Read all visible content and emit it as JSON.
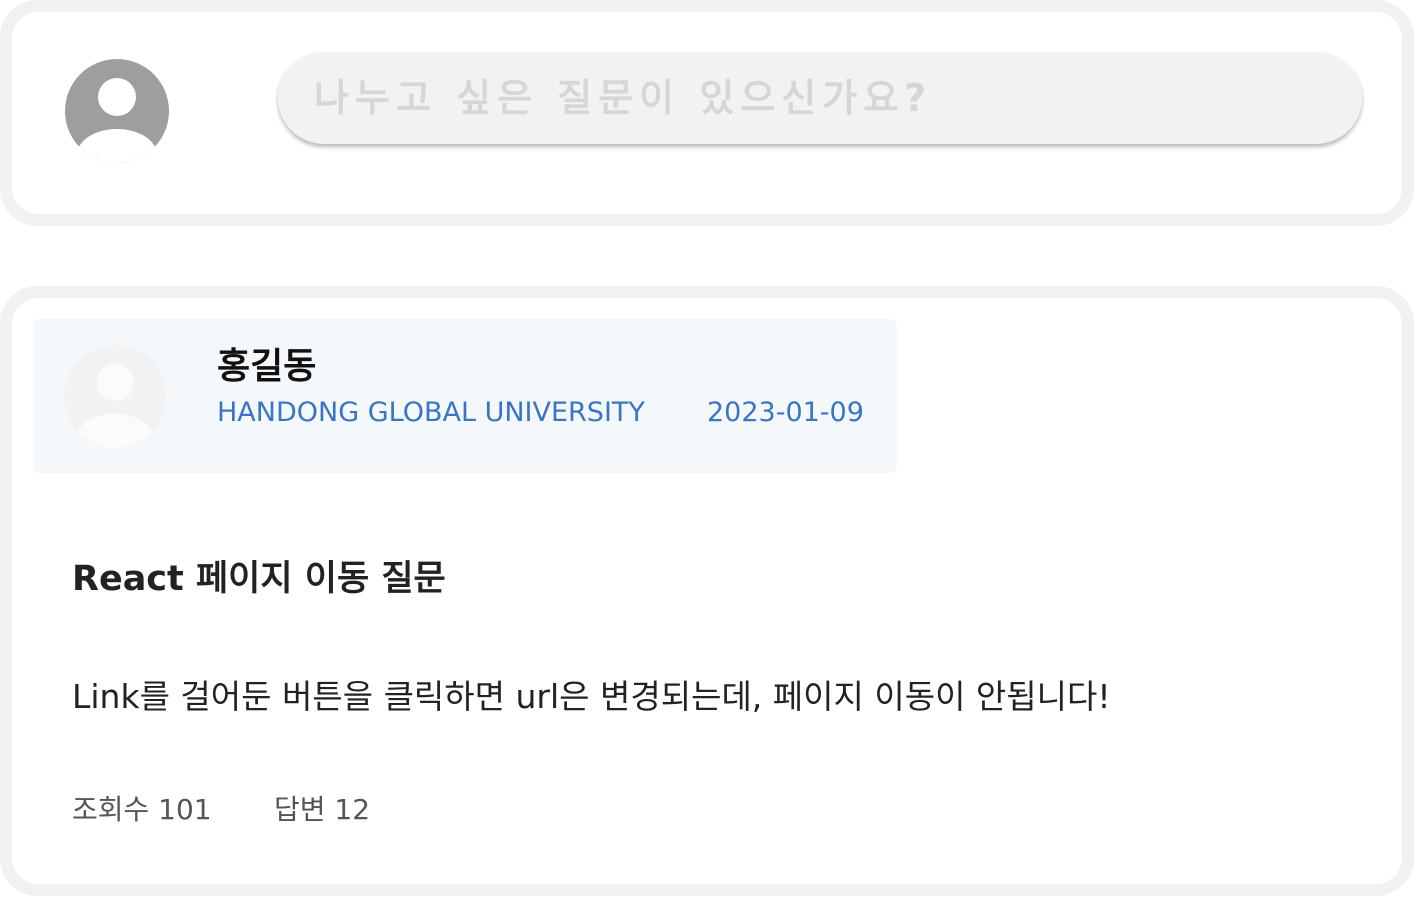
{
  "composer": {
    "placeholder": "나누고 싶은 질문이 있으신가요?"
  },
  "post": {
    "author": {
      "name": "홍길동",
      "school": "HANDONG GLOBAL UNIVERSITY",
      "date": "2023-01-09"
    },
    "title": "React 페이지 이동 질문",
    "body": "Link를 걸어둔 버튼을 클릭하면 url은 변경되는데, 페이지 이동이 안됩니다!",
    "stats": {
      "views_label": "조회수 101",
      "answers_label": "답변 12"
    }
  },
  "colors": {
    "card_border": "#f1f1f1",
    "input_bg": "#f2f2f2",
    "author_bg": "#f5f8fb",
    "accent": "#3a74c4",
    "avatar_gray": "#9e9e9e",
    "avatar_light": "#f2f2f2"
  },
  "icons": {
    "composer_avatar": "user-avatar-icon",
    "author_avatar": "user-avatar-icon"
  }
}
